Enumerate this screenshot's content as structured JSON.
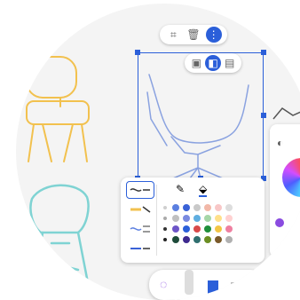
{
  "canvas": {
    "background": "#f4f4f4",
    "accent": "#2b5fd9",
    "drawings": [
      {
        "name": "yellow-chair",
        "color": "#f2c14e"
      },
      {
        "name": "blue-armchair",
        "color": "#8aa2e0"
      },
      {
        "name": "teal-chair",
        "color": "#7fd3d3"
      }
    ]
  },
  "top_toolbar": {
    "icons": [
      "crop-icon",
      "trash-icon",
      "more-icon"
    ],
    "active": "more-icon"
  },
  "mini_toolbar": {
    "icons": [
      "copy-icon",
      "duplicate-icon",
      "layers-icon"
    ],
    "active": "duplicate-icon"
  },
  "palette": {
    "tabs": [
      "pen-icon",
      "fill-icon"
    ],
    "strokes": [
      "stroke-thin",
      "stroke-medium",
      "stroke-wavy",
      "stroke-marker"
    ],
    "colors": [
      [
        "#cfcfcf",
        "#5b7fe0",
        "#3a62d7",
        "#c9c9c9",
        "#f2b8a8",
        "#f8c7c7",
        "#dddddd"
      ],
      [
        "#aaaaaa",
        "#c0c0c0",
        "#7a8ae0",
        "#5faee0",
        "#a5d6a7",
        "#ffe08a",
        "#ffd1d1"
      ],
      [
        "#333333",
        "#6d55c8",
        "#2b5fd9",
        "#d84a4a",
        "#1f8f3a",
        "#f3c544",
        "#ef7fa0"
      ],
      [
        "#222222",
        "#1e4b3a",
        "#3e2a8f",
        "#2f6f6f",
        "#6b8e23",
        "#7a5a2a",
        "#b0b0b0"
      ]
    ]
  },
  "right_panel": {
    "icons": [
      "palette-icon"
    ],
    "accent_dot": "#8a4be0"
  },
  "bottom_bar": {
    "tools": [
      "lasso-icon",
      "brush-icon",
      "marker-icon",
      "more-tools-icon"
    ]
  }
}
